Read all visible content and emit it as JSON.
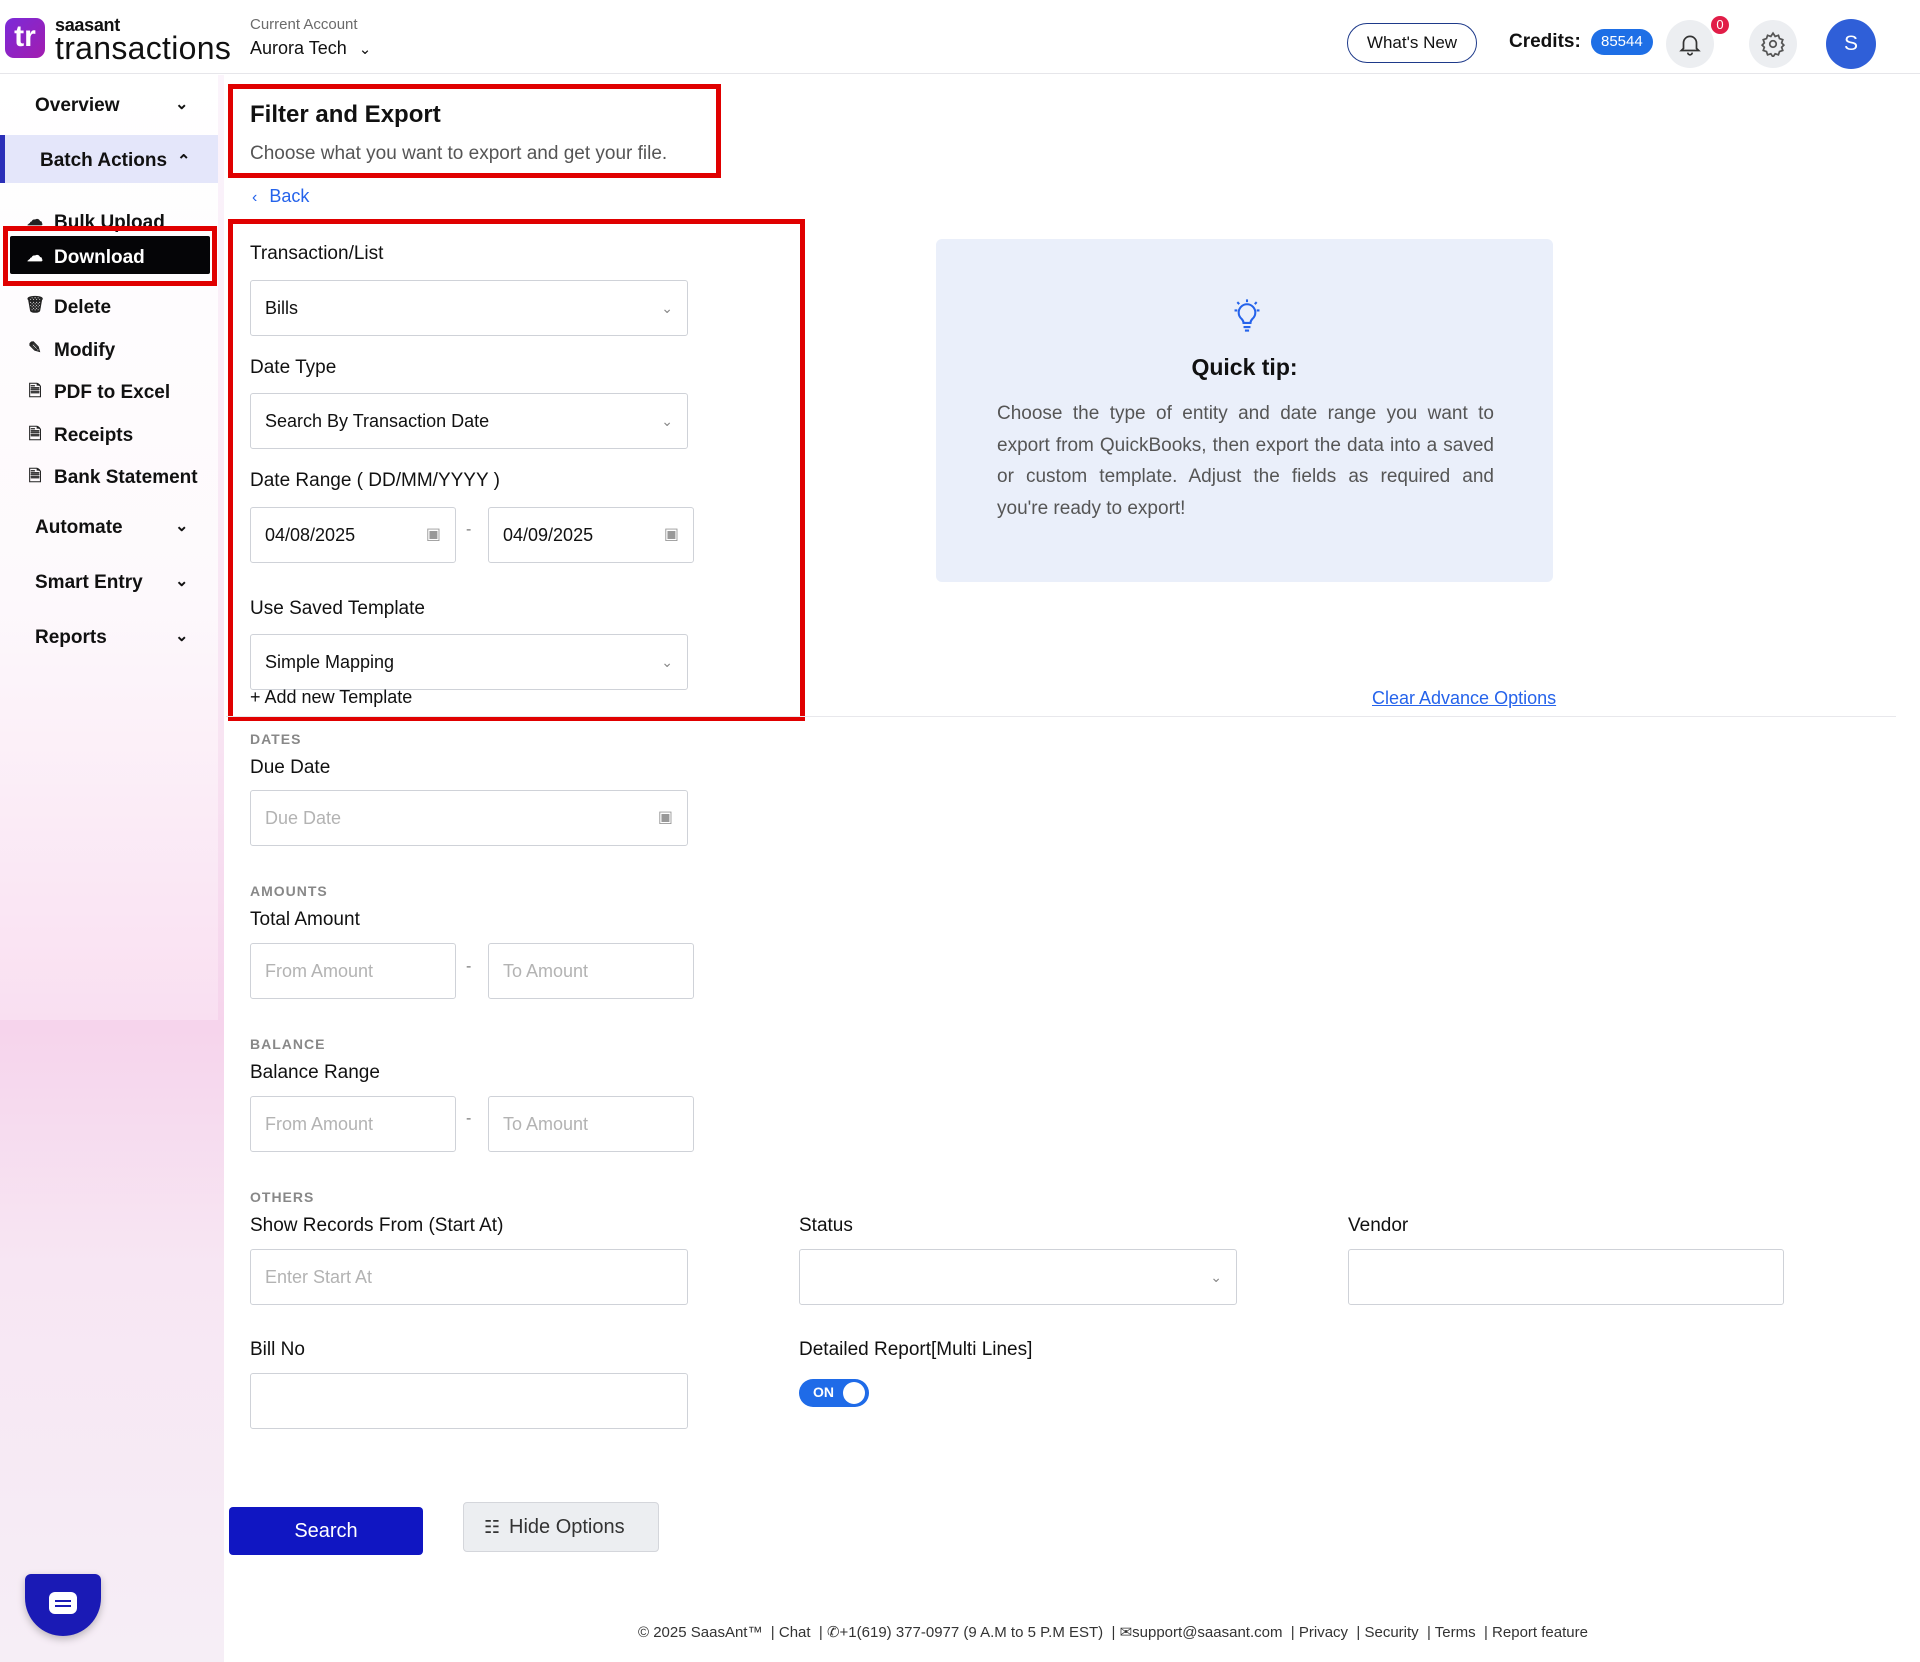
{
  "header": {
    "logo_mark": "tr",
    "logo_small": "saasant",
    "logo_big": "transactions",
    "account_label": "Current Account",
    "account_name": "Aurora Tech",
    "whats_new": "What's New",
    "credits_label": "Credits:",
    "credits_value": "85544",
    "notification_count": "0",
    "avatar_initial": "S"
  },
  "sidebar": {
    "groups": [
      {
        "label": "Overview"
      },
      {
        "label": "Batch Actions"
      },
      {
        "label": "Automate"
      },
      {
        "label": "Smart Entry"
      },
      {
        "label": "Reports"
      }
    ],
    "batch_items": [
      {
        "label": "Bulk Upload",
        "icon": "cloud-upload-icon"
      },
      {
        "label": "Download",
        "icon": "cloud-download-icon"
      },
      {
        "label": "Delete",
        "icon": "trash-icon"
      },
      {
        "label": "Modify",
        "icon": "edit-file-icon"
      },
      {
        "label": "PDF to Excel",
        "icon": "pdf-file-icon"
      },
      {
        "label": "Receipts",
        "icon": "receipt-file-icon"
      },
      {
        "label": "Bank Statement",
        "icon": "bank-file-icon"
      }
    ],
    "active_item": "Download"
  },
  "main": {
    "title": "Filter and Export",
    "subtitle": "Choose what you want to export and get your file.",
    "back_label": "Back",
    "transaction_label": "Transaction/List",
    "transaction_value": "Bills",
    "date_type_label": "Date Type",
    "date_type_value": "Search By Transaction Date",
    "date_range_label": "Date Range ( DD/MM/YYYY )",
    "date_from": "04/08/2025",
    "date_to": "04/09/2025",
    "template_label": "Use Saved Template",
    "template_value": "Simple Mapping",
    "add_template": "+ Add new Template",
    "clear_advance": "Clear Advance Options",
    "tip_title": "Quick tip:",
    "tip_body": "Choose the type of entity and date range you want to export from QuickBooks, then export the data into a saved or custom template. Adjust the fields as required and you're ready to export!",
    "dates_caption": "DATES",
    "due_date_label": "Due Date",
    "due_date_placeholder": "Due Date",
    "amounts_caption": "AMOUNTS",
    "total_amount_label": "Total Amount",
    "from_amount_placeholder": "From Amount",
    "to_amount_placeholder": "To Amount",
    "balance_caption": "BALANCE",
    "balance_label": "Balance Range",
    "others_caption": "OTHERS",
    "start_at_label": "Show Records From (Start At)",
    "start_at_placeholder": "Enter Start At",
    "status_label": "Status",
    "vendor_label": "Vendor",
    "bill_no_label": "Bill No",
    "detailed_label": "Detailed Report[Multi Lines]",
    "toggle_state": "ON",
    "search_button": "Search",
    "hide_options_button": "Hide Options"
  },
  "footer": {
    "copyright": "© 2025 SaasAnt™",
    "chat": "Chat",
    "phone": "+1(619) 377-0977 (9 A.M to 5 P.M EST)",
    "email": "support@saasant.com",
    "privacy": "Privacy",
    "security": "Security",
    "terms": "Terms",
    "report": "Report feature"
  },
  "colors": {
    "accent": "#1016c2",
    "link": "#2563eb",
    "highlight": "#e00000",
    "tip_bg": "#eaeffa"
  }
}
